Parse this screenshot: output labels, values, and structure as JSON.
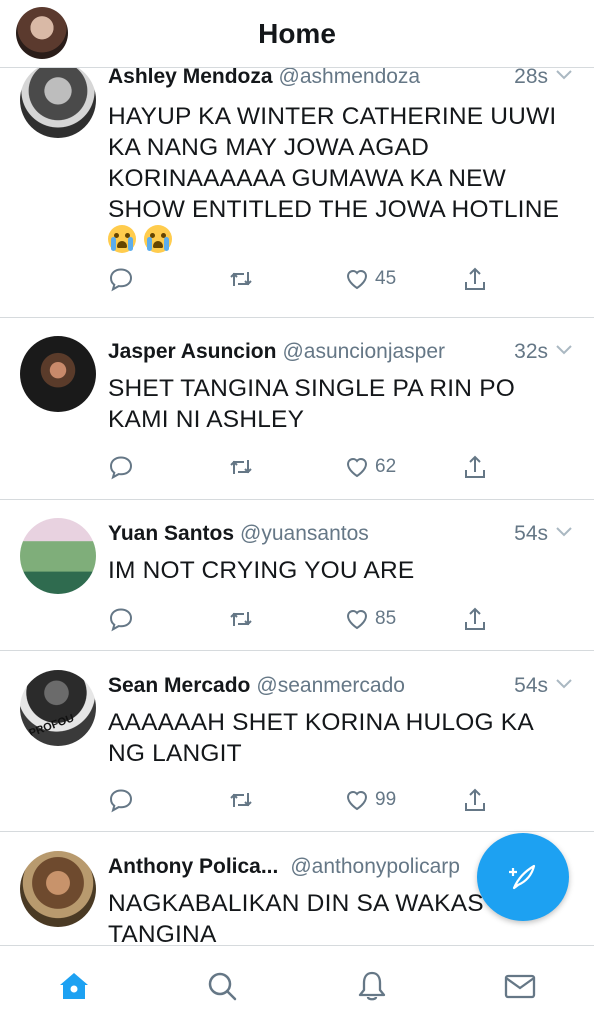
{
  "header": {
    "title": "Home"
  },
  "tweets": [
    {
      "name": "Ashley Mendoza",
      "handle": "@ashmendoza",
      "time": "28s",
      "text": "HAYUP KA WINTER CATHERINE UUWI KA NANG MAY JOWA AGAD KORINAAAAAA GUMAWA KA NEW SHOW ENTITLED THE JOWA HOTLINE",
      "emojis": [
        "😭",
        "😭"
      ],
      "likes": "45"
    },
    {
      "name": "Jasper Asuncion",
      "handle": "@asuncionjasper",
      "time": "32s",
      "text": "SHET TANGINA SINGLE PA RIN PO KAMI NI ASHLEY",
      "likes": "62"
    },
    {
      "name": "Yuan Santos",
      "handle": "@yuansantos",
      "time": "54s",
      "text": "IM NOT CRYING YOU ARE",
      "likes": "85"
    },
    {
      "name": "Sean Mercado",
      "handle": "@seanmercado",
      "time": "54s",
      "text": "AAAAAAH SHET KORINA HULOG KA NG LANGIT",
      "likes": "99"
    },
    {
      "name": "Anthony Polica...",
      "handle": "@anthonypolicarp",
      "time": "",
      "text": "NAGKABALIKAN DIN SA WAKAS TANGINA",
      "likes": ""
    }
  ],
  "avatar_text": {
    "sean": "PROFOU"
  },
  "icons": {
    "reply": "reply-icon",
    "retweet": "retweet-icon",
    "like": "heart-icon",
    "share": "share-icon",
    "compose": "compose-feather-icon",
    "home": "home-icon",
    "search": "search-icon",
    "notifications": "bell-icon",
    "messages": "mail-icon"
  },
  "colors": {
    "accent": "#1da1f2",
    "muted": "#657786",
    "text": "#14171a",
    "divider": "#d6dadd"
  }
}
